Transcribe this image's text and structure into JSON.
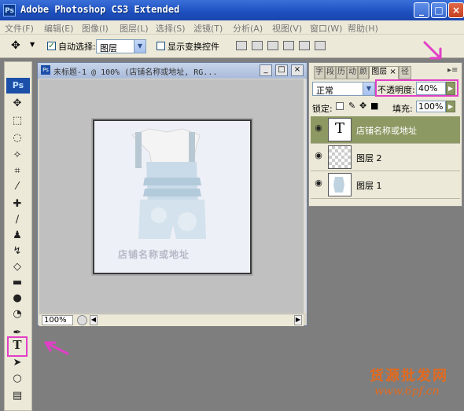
{
  "app": {
    "title": "Adobe Photoshop CS3 Extended",
    "logo": "Ps"
  },
  "menu": [
    "文件(F)",
    "编辑(E)",
    "图像(I)",
    "图层(L)",
    "选择(S)",
    "滤镜(T)",
    "分析(A)",
    "视图(V)",
    "窗口(W)",
    "帮助(H)"
  ],
  "options": {
    "auto_select_label": "自动选择:",
    "auto_select_value": "图层",
    "show_transform_label": "显示变换控件"
  },
  "document": {
    "title": "未标题-1 @ 100% (店铺名称或地址, RG...",
    "zoom": "100%",
    "watermark_text": "店铺名称或地址"
  },
  "panel": {
    "tabs": [
      "字",
      "段",
      "历",
      "动",
      "颜",
      "图层",
      "径"
    ],
    "blend_mode": "正常",
    "opacity_label": "不透明度:",
    "opacity_value": "40%",
    "lock_label": "锁定:",
    "fill_label": "填充:",
    "fill_value": "100%",
    "layers": [
      {
        "name": "店铺名称或地址",
        "type": "text",
        "thumb_glyph": "T"
      },
      {
        "name": "图层 2",
        "type": "transparent"
      },
      {
        "name": "图层 1",
        "type": "image"
      }
    ]
  },
  "footer_watermark": {
    "brand": "货源批发网",
    "url": "www.6pf.cn"
  },
  "colors": {
    "titlebar": "#1d4fbf",
    "highlight": "#e23ec8",
    "active_layer": "#8d9963"
  }
}
